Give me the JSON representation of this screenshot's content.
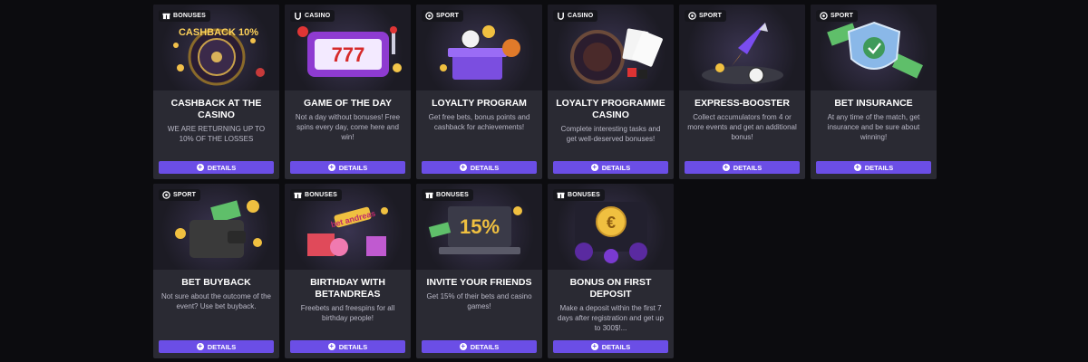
{
  "details_label": "DETAILS",
  "cards": [
    {
      "badge": "BONUSES",
      "badge_icon": "gift-icon",
      "title": "CASHBACK AT THE CASINO",
      "desc": "WE ARE RETURNING UP TO 10% OF THE LOSSES",
      "art_text": "CASHBACK 10%"
    },
    {
      "badge": "CASINO",
      "badge_icon": "horseshoe-icon",
      "title": "GAME OF THE DAY",
      "desc": "Not a day without bonuses! Free spins every day, come here and win!",
      "art_text": "777"
    },
    {
      "badge": "SPORT",
      "badge_icon": "ball-icon",
      "title": "LOYALTY PROGRAM",
      "desc": "Get free bets, bonus points and cashback for achievements!",
      "art_text": ""
    },
    {
      "badge": "CASINO",
      "badge_icon": "horseshoe-icon",
      "title": "LOYALTY PROGRAMME CASINO",
      "desc": "Complete interesting tasks and get well-deserved bonuses!",
      "art_text": ""
    },
    {
      "badge": "SPORT",
      "badge_icon": "ball-icon",
      "title": "EXPRESS-BOOSTER",
      "desc": "Collect accumulators from 4 or more events and get an additional bonus!",
      "art_text": ""
    },
    {
      "badge": "SPORT",
      "badge_icon": "ball-icon",
      "title": "BET INSURANCE",
      "desc": "At any time of the match, get insurance and be sure about winning!",
      "art_text": ""
    },
    {
      "badge": "SPORT",
      "badge_icon": "ball-icon",
      "title": "BET BUYBACK",
      "desc": "Not sure about the outcome of the event? Use bet buyback.",
      "art_text": ""
    },
    {
      "badge": "BONUSES",
      "badge_icon": "gift-icon",
      "title": "BIRTHDAY WITH BETANDREAS",
      "desc": "Freebets and freespins for all birthday people!",
      "art_text": "bet andreas"
    },
    {
      "badge": "BONUSES",
      "badge_icon": "gift-icon",
      "title": "INVITE YOUR FRIENDS",
      "desc": "Get 15% of their bets and casino games!",
      "art_text": "15%"
    },
    {
      "badge": "BONUSES",
      "badge_icon": "gift-icon",
      "title": "BONUS ON FIRST DEPOSIT",
      "desc": "Make a deposit within the first 7 days after registration and get up to 300$!...",
      "art_text": "€"
    }
  ]
}
